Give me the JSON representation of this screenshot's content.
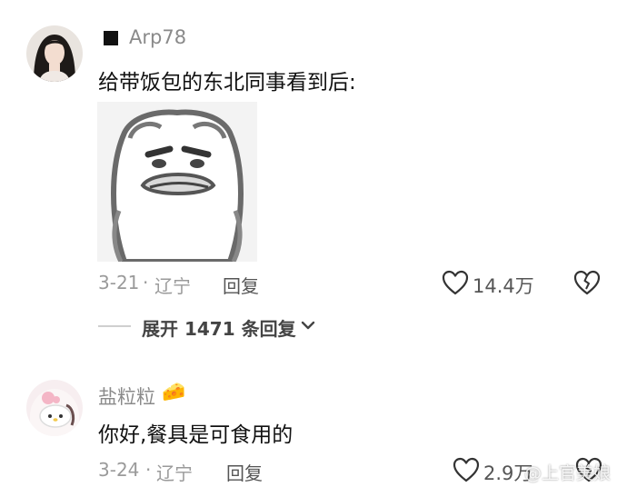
{
  "comments": [
    {
      "username": "Arp78",
      "text": "给带饭包的东北同事看到后:",
      "date": "3-21",
      "location": "辽宁",
      "reply_label": "回复",
      "like_count": "14.4万",
      "expand_label": "展开 1471 条回复"
    },
    {
      "username": "盐粒粒",
      "username_emoji": "🧀",
      "text": "你好,餐具是可食用的",
      "date": "3-24",
      "location": "辽宁",
      "reply_label": "回复",
      "like_count": "2.9万"
    }
  ],
  "watermark": "@上官美娘",
  "icons": {
    "like": "heart-icon",
    "dislike": "broken-heart-icon",
    "expand": "chevron-down-icon",
    "badge": "square-badge-icon"
  }
}
